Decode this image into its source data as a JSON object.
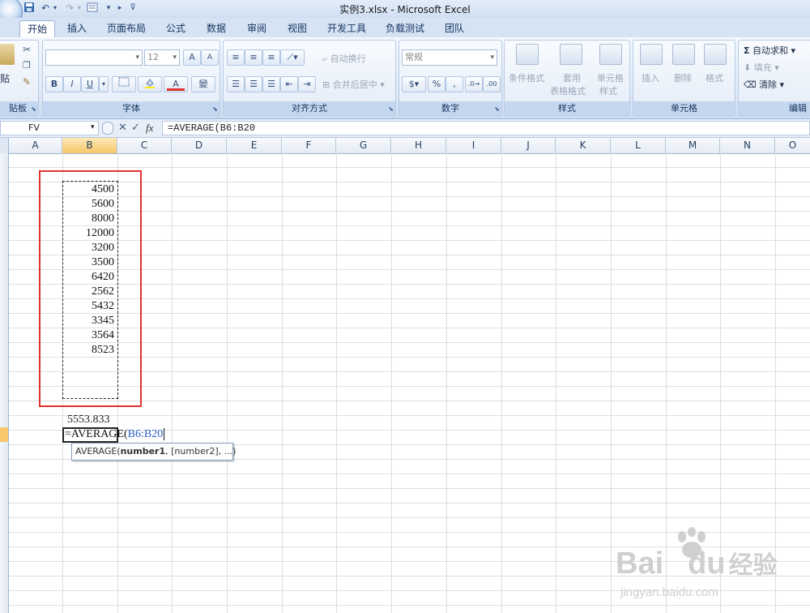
{
  "window": {
    "title": "实例3.xlsx - Microsoft Excel"
  },
  "qat": {
    "save_icon": "save-icon",
    "undo_icon": "undo-icon",
    "redo_icon": "redo-icon"
  },
  "tabs": [
    "开始",
    "插入",
    "页面布局",
    "公式",
    "数据",
    "审阅",
    "视图",
    "开发工具",
    "负载测试",
    "团队"
  ],
  "ribbon": {
    "clipboard": {
      "paste": "贴",
      "label": "贴板"
    },
    "font": {
      "font_name": "",
      "font_size": "12",
      "label": "字体",
      "bold": "B",
      "italic": "I",
      "underline": "U",
      "grow": "A",
      "shrink": "A",
      "phonetic": "變"
    },
    "alignment": {
      "wrap": "自动换行",
      "merge": "合并后居中",
      "label": "对齐方式"
    },
    "number": {
      "format": "常规",
      "percent": "%",
      "comma": ",",
      "label": "数字"
    },
    "styles": {
      "conditional": "条件格式",
      "table_1": "套用",
      "table_2": "表格格式",
      "cell_1": "单元格",
      "cell_2": "样式",
      "label": "样式"
    },
    "cells": {
      "insert": "插入",
      "delete": "删除",
      "format": "格式",
      "label": "单元格"
    },
    "editing": {
      "autosum": "自动求和",
      "fill": "填充",
      "clear": "清除",
      "label": "编辑"
    }
  },
  "formula_bar": {
    "name_box": "FV",
    "formula": "=AVERAGE(B6:B20"
  },
  "columns": [
    "A",
    "B",
    "C",
    "D",
    "E",
    "F",
    "G",
    "H",
    "I",
    "J",
    "K",
    "L",
    "M",
    "N",
    "O"
  ],
  "cells": {
    "values": [
      "4500",
      "5600",
      "8000",
      "12000",
      "3200",
      "3500",
      "6420",
      "2562",
      "5432",
      "3345",
      "3564",
      "8523"
    ],
    "average_result": "5553.833",
    "edit_prefix": "=AVERAGE(",
    "edit_ref": "B6:B20"
  },
  "tooltip": {
    "func": "AVERAGE(",
    "arg1": "number1",
    "rest": ", [number2], ...)"
  },
  "watermark": {
    "brand": "Bai",
    "brand2": "du",
    "cn": "经验",
    "url": "jingyan.baidu.com"
  },
  "colors": {
    "highlight_border": "#e0332f",
    "ref_blue": "#2d5cc7"
  }
}
